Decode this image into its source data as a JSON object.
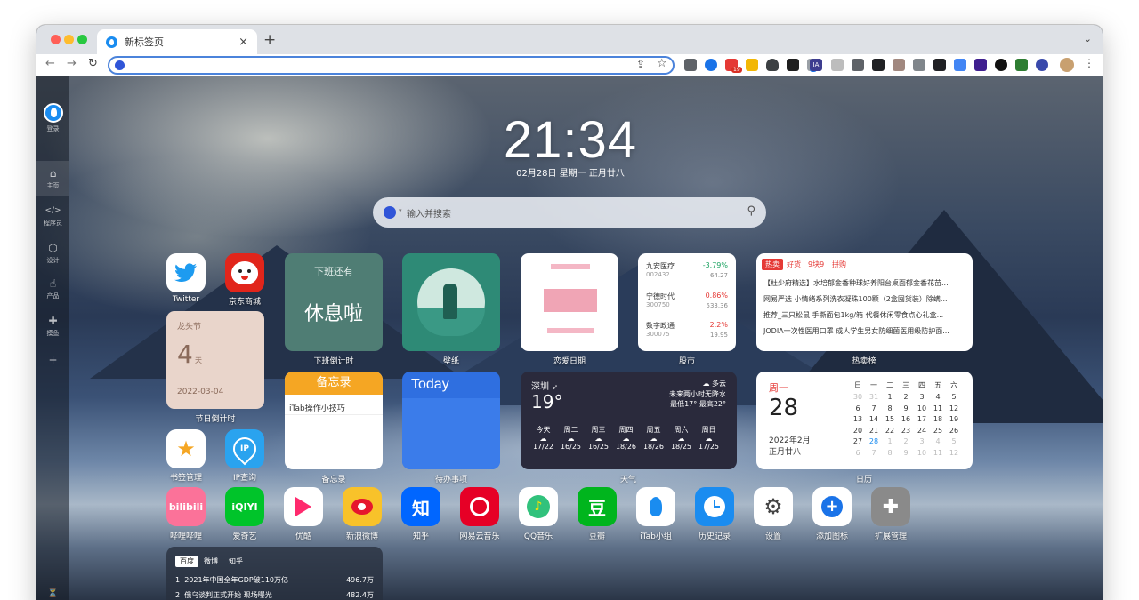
{
  "browser": {
    "tab_title": "新标签页",
    "close_glyph": "×",
    "new_tab_glyph": "+",
    "menu_glyph": "⌄",
    "ext_badge": "19",
    "ext_text_ia": "IA"
  },
  "sidebar": {
    "login": "登录",
    "items": [
      {
        "label": "主页",
        "icon": "home-icon"
      },
      {
        "label": "程序员",
        "icon": "code-icon"
      },
      {
        "label": "设计",
        "icon": "design-icon"
      },
      {
        "label": "产品",
        "icon": "thumb-up-icon"
      },
      {
        "label": "摸鱼",
        "icon": "gamepad-icon"
      }
    ],
    "add": "+"
  },
  "clock": {
    "time": "21:34",
    "date": "02月28日 星期一 正月廿八"
  },
  "search": {
    "placeholder": "输入并搜索",
    "engine": "baidu"
  },
  "apps_row1": [
    {
      "label": "Twitter",
      "color": "#ffffff"
    },
    {
      "label": "京东商城",
      "color": "#e1251b"
    }
  ],
  "apps_row3": [
    {
      "label": "书签管理",
      "color": "#ffffff"
    },
    {
      "label": "IP查询",
      "color": "#2aa3ef",
      "text": "IP"
    }
  ],
  "dock": [
    {
      "label": "哔哩哔哩",
      "color": "#fb7299",
      "text": "bilibili"
    },
    {
      "label": "爱奇艺",
      "color": "#00c42a",
      "text": "iQIYI"
    },
    {
      "label": "优酷",
      "color": "#ffffff"
    },
    {
      "label": "新浪微博",
      "color": "#f8c22a"
    },
    {
      "label": "知乎",
      "color": "#0066ff",
      "text": "知"
    },
    {
      "label": "网易云音乐",
      "color": "#e60026"
    },
    {
      "label": "QQ音乐",
      "color": "#ffffff"
    },
    {
      "label": "豆瓣",
      "color": "#00b51d",
      "text": "豆"
    },
    {
      "label": "iTab小组",
      "color": "#ffffff"
    },
    {
      "label": "历史记录",
      "color": "#1a8cf0"
    },
    {
      "label": "设置",
      "color": "#ffffff"
    },
    {
      "label": "添加图标",
      "color": "#ffffff"
    },
    {
      "label": "扩展管理",
      "color": "#8a8a8a"
    }
  ],
  "widgets": {
    "offwork": {
      "header": "下班还有",
      "value": "休息啦",
      "label": "下班倒计时"
    },
    "wallpaper": {
      "label": "壁纸"
    },
    "love_day": {
      "label": "恋爱日期"
    },
    "stocks": {
      "label": "股市",
      "rows": [
        {
          "name": "九安医疗",
          "code": "002432",
          "pct": "-3.79%",
          "price": "64.27"
        },
        {
          "name": "宁德时代",
          "code": "300750",
          "pct": "0.86%",
          "price": "533.36"
        },
        {
          "name": "数字政通",
          "code": "300075",
          "pct": "2.2%",
          "price": "19.95"
        }
      ]
    },
    "hot_sale": {
      "label": "热卖榜",
      "tabs": [
        "热卖",
        "好货",
        "9块9",
        "拼购"
      ],
      "items": [
        "【杜少府精选】水培郁金香种球好养阳台桌面郁金香花苗...",
        "网易严选 小情绪系列洗衣凝珠100颗（2盒囤货装）除螨...",
        "推荐_三只松鼠 手撕面包1kg/箱 代餐休闲零食点心礼盒...",
        "JODIA一次性医用口罩 成人学生男女防细菌医用级防护面..."
      ]
    },
    "festival": {
      "name": "龙头节",
      "days": "4",
      "unit": "天",
      "date": "2022-03-04",
      "label": "节日倒计时"
    },
    "memo": {
      "header": "备忘录",
      "item": "iTab操作小技巧",
      "label": "备忘录"
    },
    "todo": {
      "header": "Today",
      "label": "待办事项"
    },
    "weather": {
      "label": "天气",
      "city": "深圳",
      "temp": "19°",
      "condition": "多云",
      "forecast": "未来两小时无降水",
      "range": "最低17° 最高22°",
      "days": [
        {
          "day": "今天",
          "date": "17/22"
        },
        {
          "day": "周二",
          "date": "16/25"
        },
        {
          "day": "周三",
          "date": "16/25"
        },
        {
          "day": "周四",
          "date": "18/26"
        },
        {
          "day": "周五",
          "date": "18/26"
        },
        {
          "day": "周六",
          "date": "18/25"
        },
        {
          "day": "周日",
          "date": "17/25"
        }
      ]
    },
    "calendar": {
      "label": "日历",
      "weekday": "周一",
      "day": "28",
      "month": "2022年2月",
      "lunar": "正月廿八",
      "headers": [
        "日",
        "一",
        "二",
        "三",
        "四",
        "五",
        "六"
      ],
      "rows": [
        [
          "30",
          "31",
          "1",
          "2",
          "3",
          "4",
          "5"
        ],
        [
          "6",
          "7",
          "8",
          "9",
          "10",
          "11",
          "12"
        ],
        [
          "13",
          "14",
          "15",
          "16",
          "17",
          "18",
          "19"
        ],
        [
          "20",
          "21",
          "22",
          "23",
          "24",
          "25",
          "26"
        ],
        [
          "27",
          "28",
          "1",
          "2",
          "3",
          "4",
          "5"
        ],
        [
          "6",
          "7",
          "8",
          "9",
          "10",
          "11",
          "12"
        ]
      ]
    },
    "hot_search": {
      "tabs": [
        "百度",
        "微博",
        "知乎"
      ],
      "items": [
        {
          "rank": "1",
          "title": "2021年中国全年GDP破110万亿",
          "value": "496.7万"
        },
        {
          "rank": "2",
          "title": "俄乌谈判正式开始 现场曝光",
          "value": "482.4万"
        }
      ]
    }
  },
  "colors": {
    "accent": "#1a8cf0",
    "down": "#1aa260",
    "up": "#e53935",
    "memo_header": "#f5a623",
    "todo": "#2f6fe0",
    "offwork": "#4f7d74",
    "festival": "#e9d5cb"
  }
}
